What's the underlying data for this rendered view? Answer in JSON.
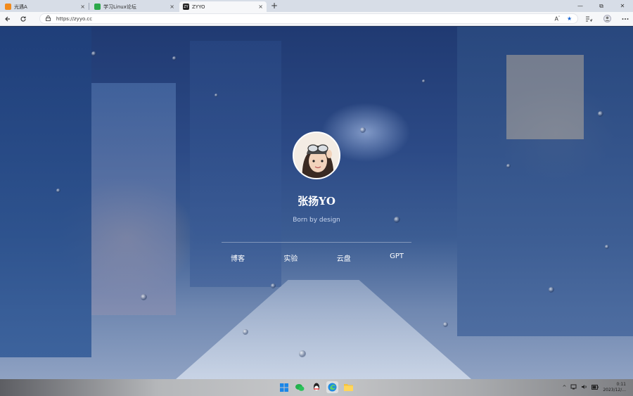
{
  "tabs": [
    {
      "title": "光遇A",
      "fav_color": "#f28a1b",
      "close": "×"
    },
    {
      "title": "学习Linux论坛",
      "fav_color": "#2ca84a",
      "close": "×"
    },
    {
      "title": "ZYYO",
      "fav_icon_text": "ZY",
      "fav_color": "#222222",
      "close": "×",
      "active": true
    }
  ],
  "newtab_label": "+",
  "window_controls": {
    "minimize": "—",
    "restore": "⧉",
    "close": "✕"
  },
  "address_bar": {
    "url": "https://zyyo.cc"
  },
  "page": {
    "name": "张扬YO",
    "tagline": "Born by design",
    "nav": [
      "博客",
      "实验",
      "云盘",
      "GPT"
    ]
  },
  "taskbar": {
    "icons": [
      "windows-start-icon",
      "wechat-icon",
      "qq-icon",
      "edge-icon",
      "file-explorer-icon"
    ],
    "tray_chevron": "^",
    "time": "0:11",
    "date": "2023/12/..."
  },
  "colors": {
    "star_active": "#1463d4",
    "page_accent": "#ffffff"
  }
}
